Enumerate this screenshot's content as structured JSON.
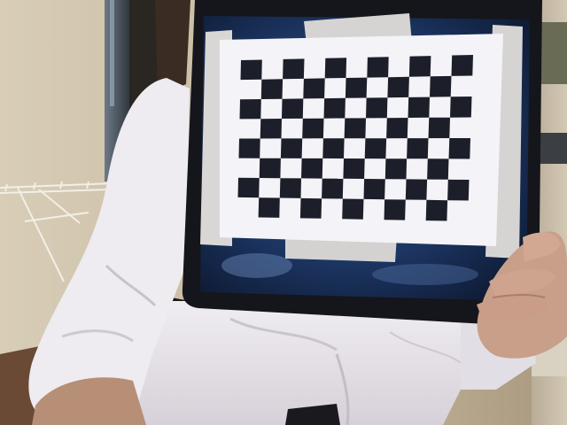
{
  "scene": {
    "kind": "webcam-photo",
    "subject": "person-holding-tablet-with-checkerboard",
    "checkerboard": {
      "columns": 11,
      "rows": 8,
      "dark_color": "#1c1f2a",
      "light_color": "#f4f3f7"
    },
    "colors": {
      "wall": "#c9bca3",
      "shirt": "#e6e3ea",
      "tablet_frame": "#15161b",
      "tablet_screen": "#1d3a6a",
      "paper": "#f4f3f7",
      "tape": "#d6d4d3",
      "skin": "#c79a83",
      "floor": "#6a4a35"
    }
  }
}
